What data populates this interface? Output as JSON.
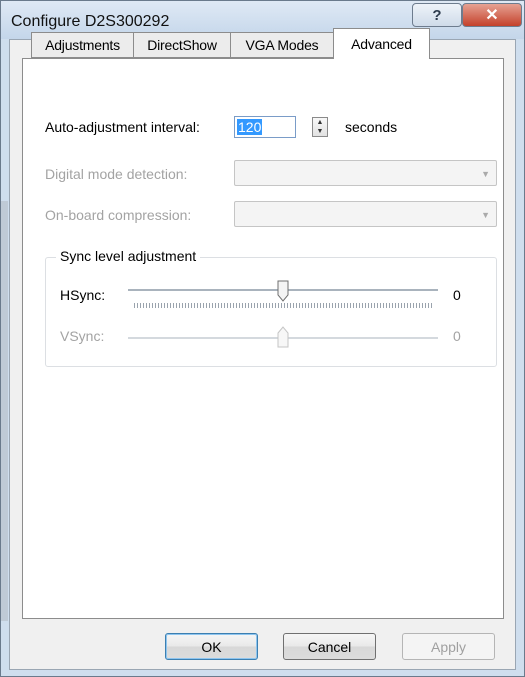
{
  "window": {
    "title": "Configure D2S300292",
    "help_glyph": "?",
    "close_glyph": "✕"
  },
  "tabs": [
    {
      "label": "Adjustments",
      "active": false
    },
    {
      "label": "DirectShow",
      "active": false
    },
    {
      "label": "VGA Modes",
      "active": false
    },
    {
      "label": "Advanced",
      "active": true
    }
  ],
  "advanced": {
    "auto_adjust_label": "Auto-adjustment interval:",
    "auto_adjust_value": "120",
    "auto_adjust_unit": "seconds",
    "digital_mode_label": "Digital mode detection:",
    "digital_mode_value": "",
    "compression_label": "On-board compression:",
    "compression_value": "",
    "sync_group_title": "Sync level adjustment",
    "hsync_label": "HSync:",
    "hsync_value": "0",
    "vsync_label": "VSync:",
    "vsync_value": "0"
  },
  "buttons": {
    "ok": "OK",
    "cancel": "Cancel",
    "apply": "Apply"
  },
  "colors": {
    "selection": "#3399ff",
    "disabled_text": "#a3a3a3"
  }
}
